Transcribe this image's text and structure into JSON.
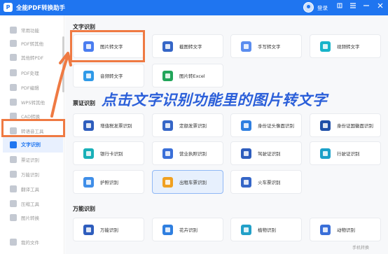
{
  "titlebar": {
    "app_title": "全能PDF转换助手",
    "logo_glyph": "P",
    "login_label": "登录",
    "icons": [
      "skin-icon",
      "menu-icon",
      "minimize-icon",
      "close-icon"
    ],
    "accent": "#1f75f0"
  },
  "sidebar": {
    "items": [
      {
        "label": "常用功能"
      },
      {
        "label": "PDF转其他"
      },
      {
        "label": "其他转PDF"
      },
      {
        "label": "PDF处理"
      },
      {
        "label": "PDF编辑"
      },
      {
        "label": "WPS转其他"
      },
      {
        "label": "CAD转换"
      },
      {
        "label": "转语音工具"
      },
      {
        "label": "文字识别",
        "active": true
      },
      {
        "label": "票证识别"
      },
      {
        "label": "万能识别"
      },
      {
        "label": "翻译工具"
      },
      {
        "label": "压缩工具"
      },
      {
        "label": "图片转换"
      },
      {
        "label": "我的文件"
      }
    ]
  },
  "sections": {
    "text_recognition": {
      "title": "文字识别",
      "cards": [
        "图片转文字",
        "截图转文字",
        "手写转文字",
        "视频转文字",
        "音频转文字",
        "图片转Excel"
      ]
    },
    "ticket_recognition": {
      "title": "票证识别",
      "cards": [
        "增值税发票识别",
        "定额发票识别",
        "身份证头像面识别",
        "身份证国徽面识别",
        "银行卡识别",
        "营业执照识别",
        "驾驶证识别",
        "行驶证识别",
        "护照识别",
        "出租车票识别",
        "火车票识别"
      ]
    },
    "universal_recognition": {
      "title": "万能识别",
      "cards": [
        "万能识别",
        "花卉识别",
        "植物识别",
        "动物识别"
      ]
    }
  },
  "annotation": {
    "text": "点击文字识别功能里的图片转文字",
    "color": "#2b5fd9",
    "highlight_color": "#ef7a43"
  },
  "watermark": "手机转换"
}
